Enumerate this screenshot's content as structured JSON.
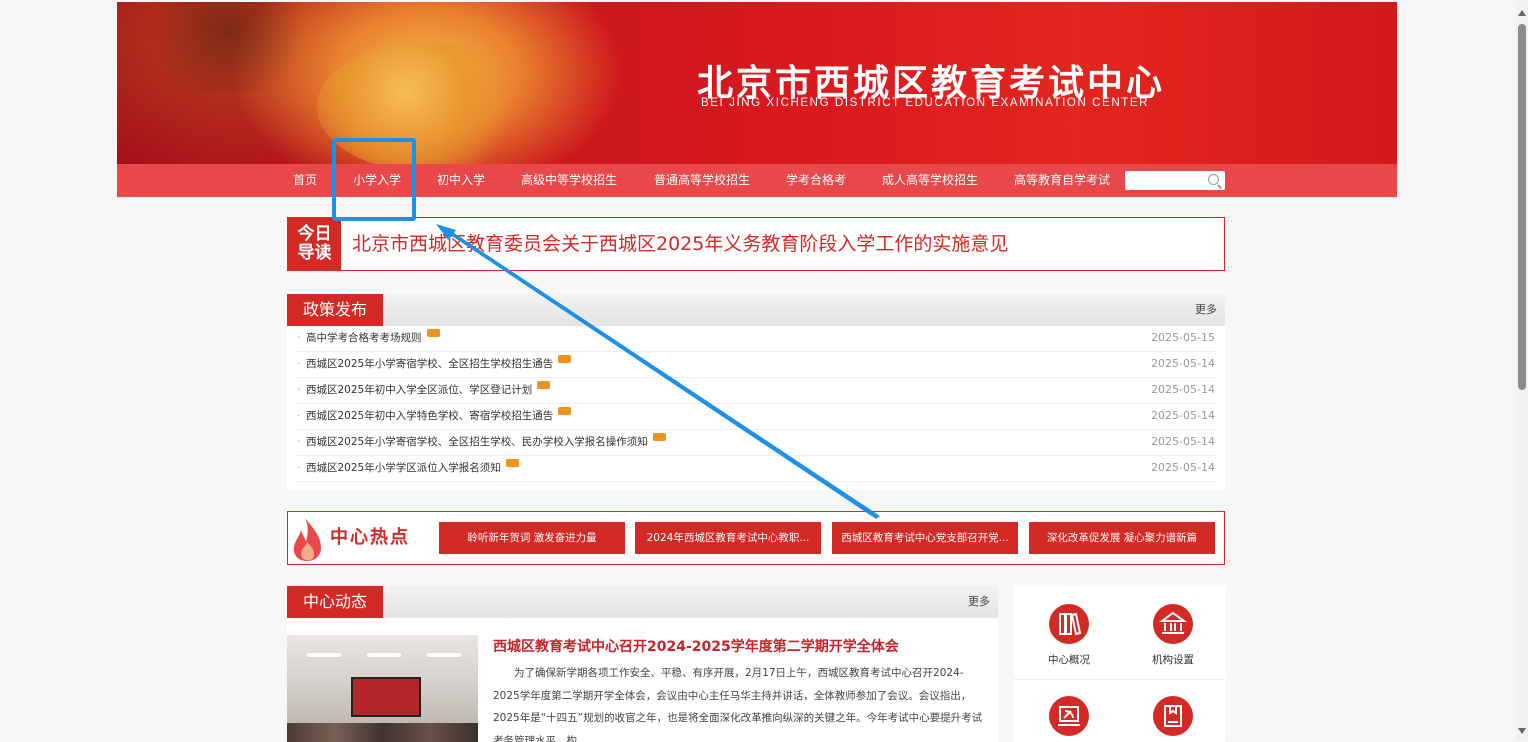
{
  "header": {
    "title": "北京市西城区教育考试中心",
    "subtitle": "BEI JING XICHENG DISTRICT EDUCATION EXAMINATION  CENTER"
  },
  "nav": {
    "items": [
      "首页",
      "小学入学",
      "初中入学",
      "高级中等学校招生",
      "普通高等学校招生",
      "学考合格考",
      "成人高等学校招生",
      "高等教育自学考试"
    ],
    "search_placeholder": ""
  },
  "today": {
    "badge_line1": "今日",
    "badge_line2": "导读",
    "headline": "北京市西城区教育委员会关于西城区2025年义务教育阶段入学工作的实施意见"
  },
  "policy": {
    "tab": "政策发布",
    "more": "更多",
    "items": [
      {
        "title": "高中学考合格考考场规则",
        "date": "2025-05-15"
      },
      {
        "title": "西城区2025年小学寄宿学校、全区招生学校招生通告",
        "date": "2025-05-14"
      },
      {
        "title": "西城区2025年初中入学全区派位、学区登记计划",
        "date": "2025-05-14"
      },
      {
        "title": "西城区2025年初中入学特色学校、寄宿学校招生通告",
        "date": "2025-05-14"
      },
      {
        "title": "西城区2025年小学寄宿学校、全区招生学校、民办学校入学报名操作须知",
        "date": "2025-05-14"
      },
      {
        "title": "西城区2025年小学学区派位入学报名须知",
        "date": "2025-05-14"
      }
    ]
  },
  "hot": {
    "title": "中心热点",
    "buttons": [
      "聆听新年贺词 激发奋进力量",
      "2024年西城区教育考试中心教职...",
      "西城区教育考试中心党支部召开党...",
      "深化改革促发展 凝心聚力谱新篇"
    ]
  },
  "news": {
    "tab": "中心动态",
    "more": "更多",
    "headline": "西城区教育考试中心召开2024-2025学年度第二学期开学全体会",
    "body": "为了确保新学期各项工作安全、平稳、有序开展，2月17日上午，西城区教育考试中心召开2024-2025学年度第二学期开学全体会，会议由中心主任马华主持并讲话，全体教师参加了会议。会议指出，2025年是“十四五”规划的收官之年，也是将全面深化改革推向纵深的关键之年。今年考试中心要提升考试考务管理水平，构..."
  },
  "side": {
    "items": [
      {
        "label": "中心概况",
        "icon": "books-icon"
      },
      {
        "label": "机构设置",
        "icon": "building-icon"
      },
      {
        "label": "",
        "icon": "party-emblem-icon"
      },
      {
        "label": "",
        "icon": "document-icon"
      }
    ]
  },
  "colors": {
    "brand_red": "#d32a25",
    "nav_red": "#e8484a",
    "annotation_blue": "#1e90e6",
    "new_tag": "#f0921f"
  }
}
